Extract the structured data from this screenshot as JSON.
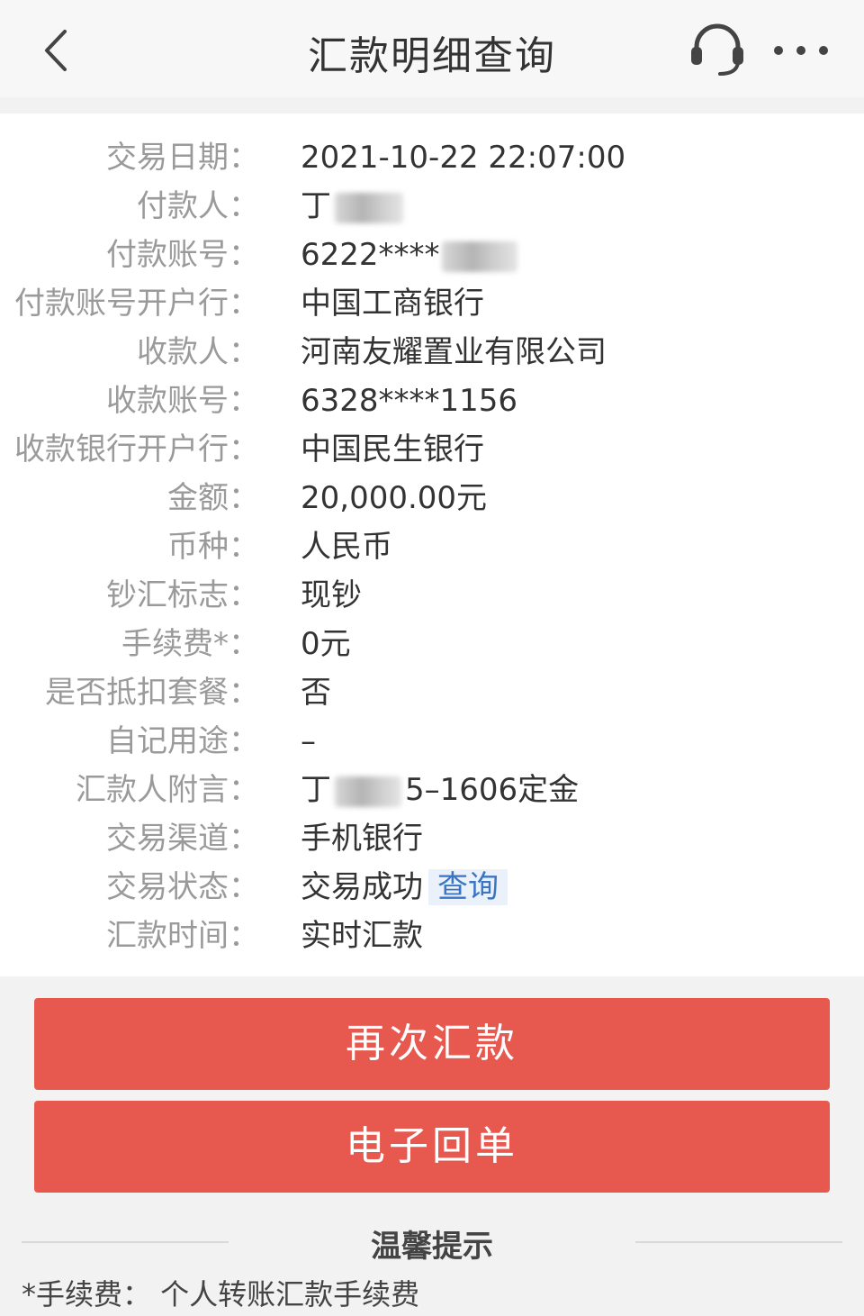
{
  "header": {
    "title": "汇款明细查询",
    "back_icon": "chevron-left-icon",
    "support_icon": "headset-icon",
    "more_icon": "more-dots-icon"
  },
  "details": [
    {
      "label": "交易日期：",
      "value": "2021-10-22 22:07:00"
    },
    {
      "label": "付款人：",
      "value": "丁"
    },
    {
      "label": "付款账号：",
      "value": "6222****"
    },
    {
      "label": "付款账号开户行：",
      "value": "中国工商银行"
    },
    {
      "label": "收款人：",
      "value": "河南友耀置业有限公司"
    },
    {
      "label": "收款账号：",
      "value": "6328****1156"
    },
    {
      "label": "收款银行开户行：",
      "value": "中国民生银行"
    },
    {
      "label": "金额：",
      "value": "20,000.00元"
    },
    {
      "label": "币种：",
      "value": "人民币"
    },
    {
      "label": "钞汇标志：",
      "value": "现钞"
    },
    {
      "label": "手续费*：",
      "value": "0元"
    },
    {
      "label": "是否抵扣套餐：",
      "value": "否"
    },
    {
      "label": "自记用途：",
      "value": "–"
    },
    {
      "label": "汇款人附言：",
      "value": "丁",
      "value_suffix": "5–1606定金"
    },
    {
      "label": "交易渠道：",
      "value": "手机银行"
    },
    {
      "label": "交易状态：",
      "value": "交易成功",
      "link": "查询"
    },
    {
      "label": "汇款时间：",
      "value": "实时汇款"
    }
  ],
  "buttons": {
    "remit_again": "再次汇款",
    "e_receipt": "电子回单"
  },
  "tips": {
    "title": "温馨提示",
    "text": "*手续费：  个人转账汇款手续费"
  },
  "colors": {
    "primary_button": "#e7584f",
    "link": "#3a75c4"
  }
}
